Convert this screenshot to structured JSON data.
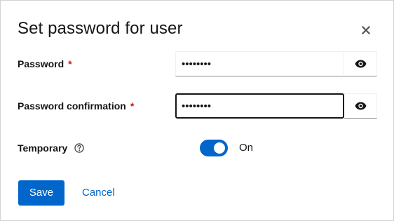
{
  "modal": {
    "title": "Set password for user",
    "close_icon": "close-icon"
  },
  "form": {
    "password": {
      "label": "Password",
      "required_mark": "*",
      "value": "••••••••",
      "toggle_icon": "eye-icon"
    },
    "password_confirmation": {
      "label": "Password confirmation",
      "required_mark": "*",
      "value": "••••••••",
      "toggle_icon": "eye-icon"
    },
    "temporary": {
      "label": "Temporary",
      "help_icon": "help-circle-icon",
      "toggle_state": "On"
    }
  },
  "actions": {
    "save_label": "Save",
    "cancel_label": "Cancel"
  },
  "colors": {
    "primary": "#0066cc",
    "required": "#c9190b",
    "text": "#151515"
  }
}
